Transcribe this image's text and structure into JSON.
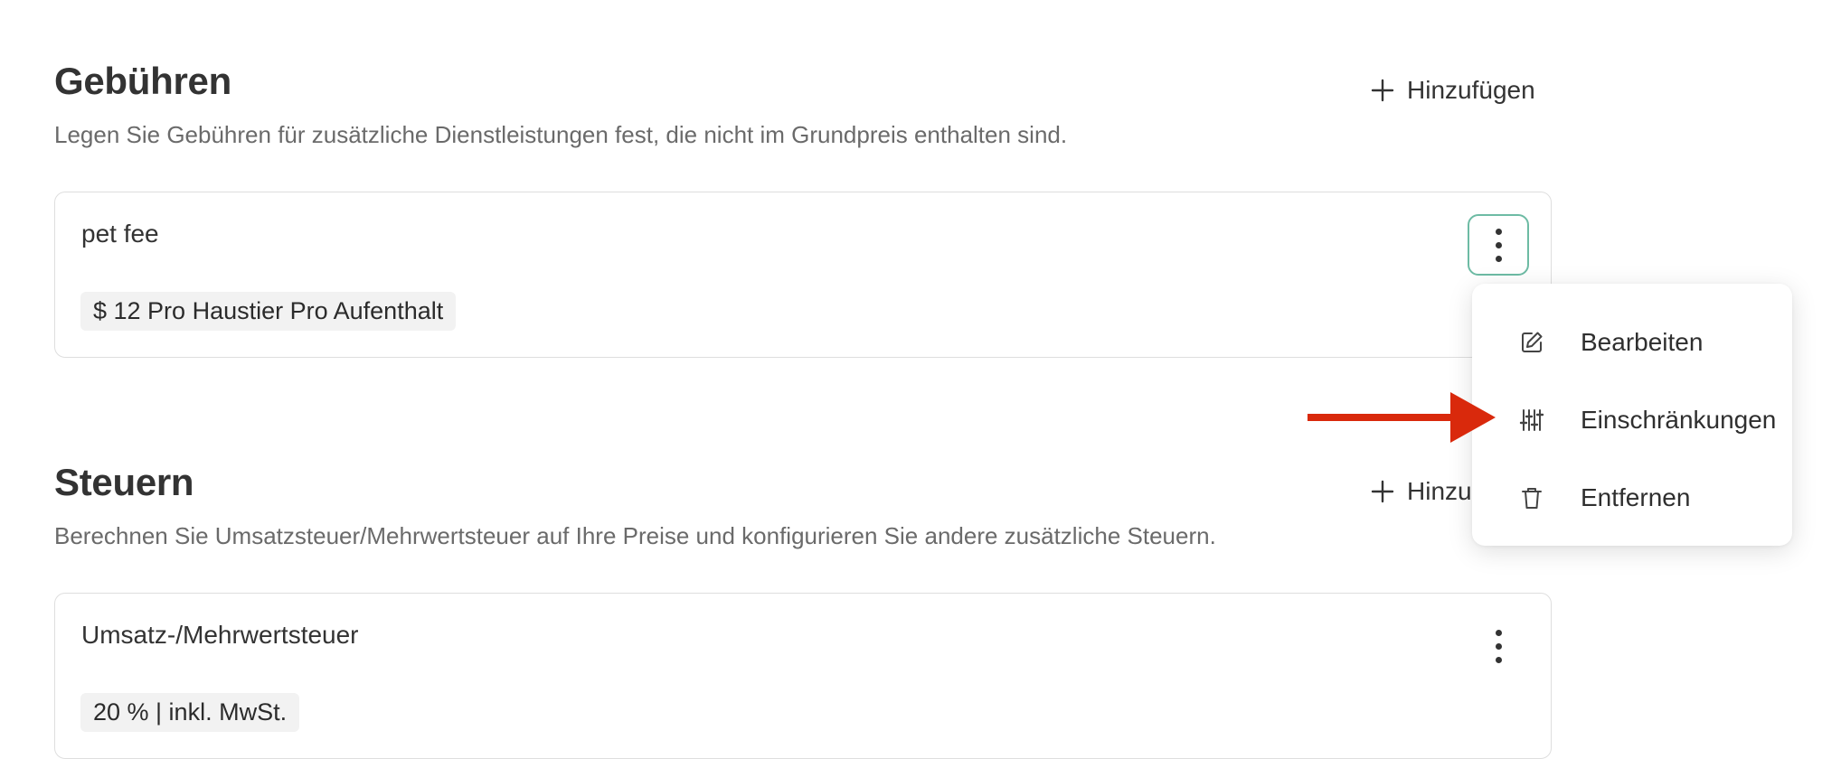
{
  "fees": {
    "title": "Gebühren",
    "description": "Legen Sie Gebühren für zusätzliche Dienstleistungen fest, die nicht im Grundpreis enthalten sind.",
    "add_label": "Hinzufügen",
    "items": [
      {
        "name": "pet fee",
        "tag": "$ 12 Pro Haustier Pro Aufenthalt"
      }
    ]
  },
  "taxes": {
    "title": "Steuern",
    "description": "Berechnen Sie Umsatzsteuer/Mehrwertsteuer auf Ihre Preise und konfigurieren Sie andere zusätzliche Steuern.",
    "add_label": "Hinzufügen",
    "items": [
      {
        "name": "Umsatz-/Mehrwertsteuer",
        "tag": "20 % | inkl. MwSt."
      }
    ]
  },
  "context_menu": {
    "items": [
      {
        "label": "Bearbeiten",
        "icon": "edit-icon"
      },
      {
        "label": "Einschränkungen",
        "icon": "sliders-icon"
      },
      {
        "label": "Entfernen",
        "icon": "trash-icon"
      }
    ]
  },
  "colors": {
    "active_border": "#6dbba4",
    "annotation_arrow": "#d9290c"
  }
}
